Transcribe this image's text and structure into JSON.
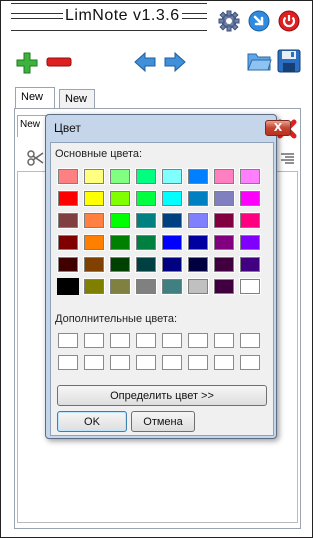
{
  "app": {
    "title": "LimNote v1.3.6"
  },
  "toolbar": {
    "settings_icon": "gear-icon",
    "minimize_icon": "arrow-down-right-icon",
    "power_icon": "power-icon",
    "add_icon": "plus-icon",
    "remove_icon": "minus-icon",
    "back_icon": "arrow-left-icon",
    "forward_icon": "arrow-right-icon",
    "open_icon": "folder-icon",
    "save_icon": "floppy-disk-icon"
  },
  "tabs": [
    {
      "label": "New"
    },
    {
      "label": "New"
    }
  ],
  "subtab": {
    "label": "New"
  },
  "dialog": {
    "title": "Цвет",
    "close_label": "X",
    "basic_colors_label": "Основные цвета:",
    "custom_colors_label": "Дополнительные цвета:",
    "define_button": "Определить цвет >>",
    "ok_button": "OK",
    "cancel_button": "Отмена",
    "selected_color": "#000000",
    "basic_colors": [
      [
        "#FF8080",
        "#FFFF80",
        "#80FF80",
        "#00FF80",
        "#80FFFF",
        "#0080FF",
        "#FF80C0",
        "#FF80FF"
      ],
      [
        "#FF0000",
        "#FFFF00",
        "#80FF00",
        "#00FF40",
        "#00FFFF",
        "#0080C0",
        "#8080C0",
        "#FF00FF"
      ],
      [
        "#804040",
        "#FF8040",
        "#00FF00",
        "#008080",
        "#004080",
        "#8080FF",
        "#800040",
        "#FF0080"
      ],
      [
        "#800000",
        "#FF8000",
        "#008000",
        "#008040",
        "#0000FF",
        "#0000A0",
        "#800080",
        "#8000FF"
      ],
      [
        "#400000",
        "#804000",
        "#004000",
        "#004040",
        "#000080",
        "#000040",
        "#400040",
        "#400080"
      ],
      [
        "#000000",
        "#808000",
        "#808040",
        "#808080",
        "#408080",
        "#C0C0C0",
        "#400040",
        "#FFFFFF"
      ]
    ],
    "custom_colors": [
      [
        "#FFFFFF",
        "#FFFFFF",
        "#FFFFFF",
        "#FFFFFF",
        "#FFFFFF",
        "#FFFFFF",
        "#FFFFFF",
        "#FFFFFF"
      ],
      [
        "#FFFFFF",
        "#FFFFFF",
        "#FFFFFF",
        "#FFFFFF",
        "#FFFFFF",
        "#FFFFFF",
        "#FFFFFF",
        "#FFFFFF"
      ]
    ]
  },
  "colors": {
    "accent_red": "#E02020",
    "accent_green": "#3DB23D",
    "accent_blue": "#2E8BDF",
    "dialog_frame": "#C5D6EA"
  }
}
